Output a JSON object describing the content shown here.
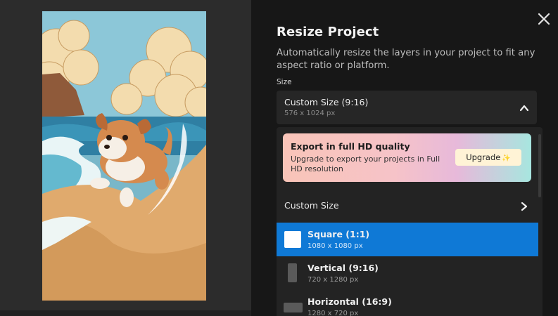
{
  "dialog": {
    "title": "Resize Project",
    "description": "Automatically resize the layers in your project to fit any aspect ratio or platform.",
    "size_label": "Size",
    "close_icon": "close-icon"
  },
  "size_select": {
    "selected_title": "Custom Size (9:16)",
    "selected_dims": "576 x 1024 px",
    "icon": "chevron-up-icon"
  },
  "promo": {
    "title": "Export in full HD quality",
    "text": "Upgrade to export your projects in Full HD resolution",
    "button_label": "Upgrade",
    "button_icon": "sparkle-icon"
  },
  "custom_size": {
    "label": "Custom Size",
    "icon": "chevron-right-icon"
  },
  "options": [
    {
      "title": "Square (1:1)",
      "dims": "1080 x 1080 px",
      "selected": true,
      "icon": "square-shape-icon"
    },
    {
      "title": "Vertical (9:16)",
      "dims": "720 x 1280 px",
      "selected": false,
      "icon": "vertical-shape-icon"
    },
    {
      "title": "Horizontal (16:9)",
      "dims": "1280 x 720 px",
      "selected": false,
      "icon": "horizontal-shape-icon"
    }
  ],
  "colors": {
    "selected_accent": "#0f79d6",
    "panel_bg": "#171717",
    "canvas_bg": "#2c2c2c"
  }
}
